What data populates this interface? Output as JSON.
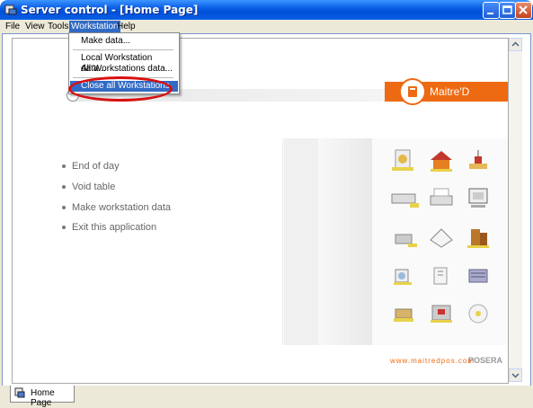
{
  "window": {
    "title": "Server control - [Home Page]"
  },
  "menubar": {
    "items": [
      "File",
      "View",
      "Tools",
      "Workstation",
      "Help"
    ],
    "active_index": 3
  },
  "workstation_menu": {
    "items": [
      "Make data...",
      "Local Workstation data...",
      "All Workstations data...",
      "Close all Workstations"
    ],
    "highlighted": "Close all Workstations"
  },
  "content": {
    "brand": "Maitre'D",
    "links": [
      "End of day",
      "Void table",
      "Make workstation data",
      "Exit this application"
    ],
    "footer_url": "www.maitredpos.com",
    "footer_brand": "POSERA"
  },
  "tabs": [
    {
      "label": "Home Page"
    }
  ],
  "colors": {
    "title_blue": "#0a5fe6",
    "brand_orange": "#ee6a12",
    "menu_highlight": "#316ac5",
    "annotation_red": "#d81010"
  },
  "icons": {
    "app": "server-control-icon",
    "tab": "home-page-icon",
    "minimize": "minimize-icon",
    "maximize": "maximize-icon",
    "close": "close-icon"
  }
}
